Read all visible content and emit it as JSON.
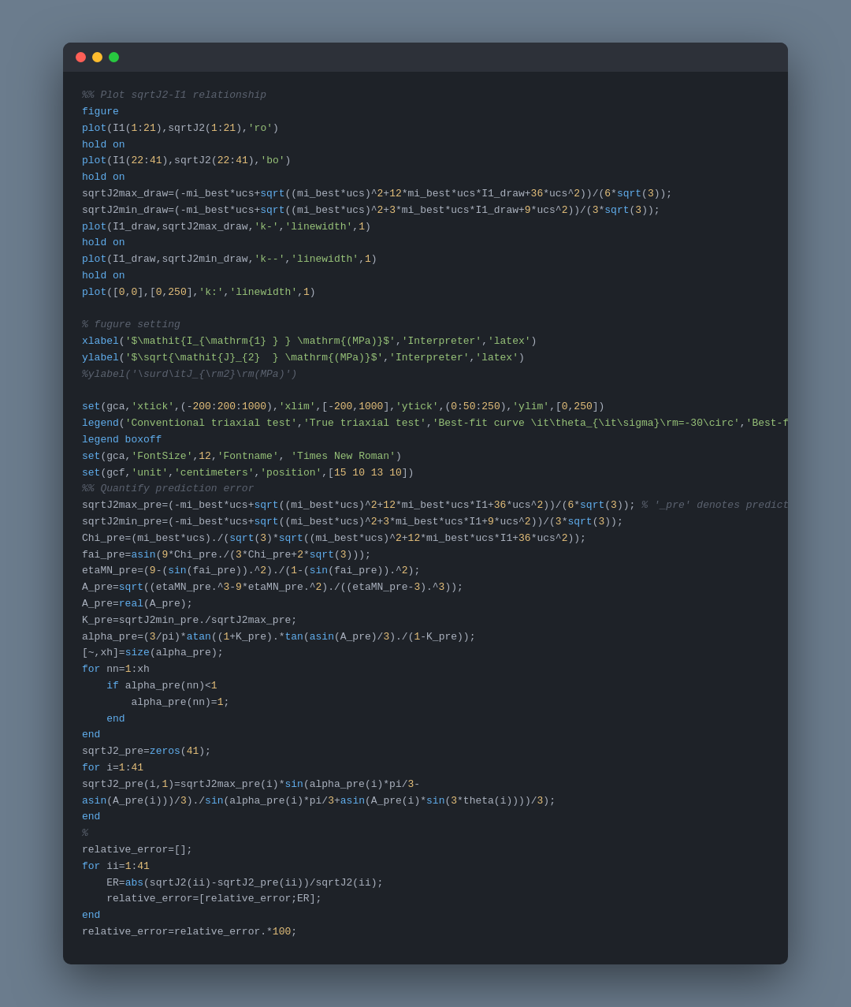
{
  "window": {
    "dots": [
      "red",
      "yellow",
      "green"
    ]
  },
  "code": {
    "lines": "code content rendered via HTML"
  }
}
